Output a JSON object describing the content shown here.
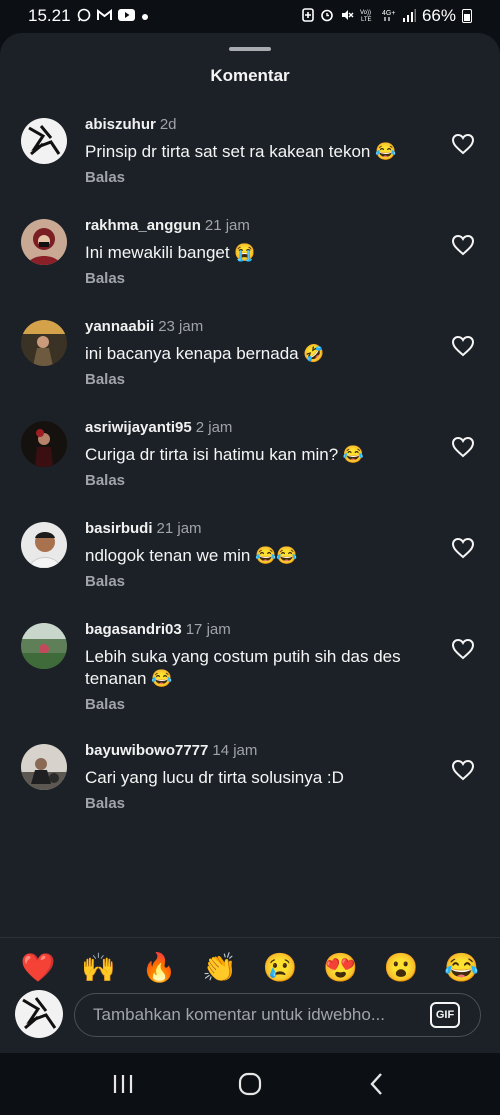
{
  "status": {
    "time": "15.21",
    "battery": "66%",
    "left_icons": [
      "whatsapp-icon",
      "gmail-icon",
      "youtube-icon",
      "dot-icon"
    ],
    "right_icons": [
      "battery-saver-icon",
      "alarm-icon",
      "mute-icon",
      "volte-icon",
      "4g-icon",
      "signal-icon"
    ]
  },
  "sheet": {
    "title": "Komentar"
  },
  "comments": [
    {
      "user": "abiszuhur",
      "time": "2d",
      "text": "Prinsip dr tirta sat set ra kakean tekon 😂",
      "reply": "Balas"
    },
    {
      "user": "rakhma_anggun",
      "time": "21 jam",
      "text": "Ini mewakili banget 😭",
      "reply": "Balas"
    },
    {
      "user": "yannaabii",
      "time": "23 jam",
      "text": "ini bacanya kenapa bernada 🤣",
      "reply": "Balas"
    },
    {
      "user": "asriwijayanti95",
      "time": "2 jam",
      "text": "Curiga dr tirta isi hatimu kan min? 😂",
      "reply": "Balas"
    },
    {
      "user": "basirbudi",
      "time": "21 jam",
      "text": "ndlogok tenan we min 😂😂",
      "reply": "Balas"
    },
    {
      "user": "bagasandri03",
      "time": "17 jam",
      "text": "Lebih suka yang costum putih sih das des tenanan 😂",
      "reply": "Balas"
    },
    {
      "user": "bayuwibowo7777",
      "time": "14 jam",
      "text": "Cari yang lucu dr tirta solusinya :D",
      "reply": "Balas"
    }
  ],
  "emojis": [
    "❤️",
    "🙌",
    "🔥",
    "👏",
    "😢",
    "😍",
    "😮",
    "😂"
  ],
  "input": {
    "placeholder": "Tambahkan komentar untuk idwebho...",
    "gif_label": "GIF"
  },
  "colors": {
    "sheet_bg": "#1c2127",
    "screen_bg": "#0c0f14",
    "secondary_text": "#a0a4aa"
  }
}
